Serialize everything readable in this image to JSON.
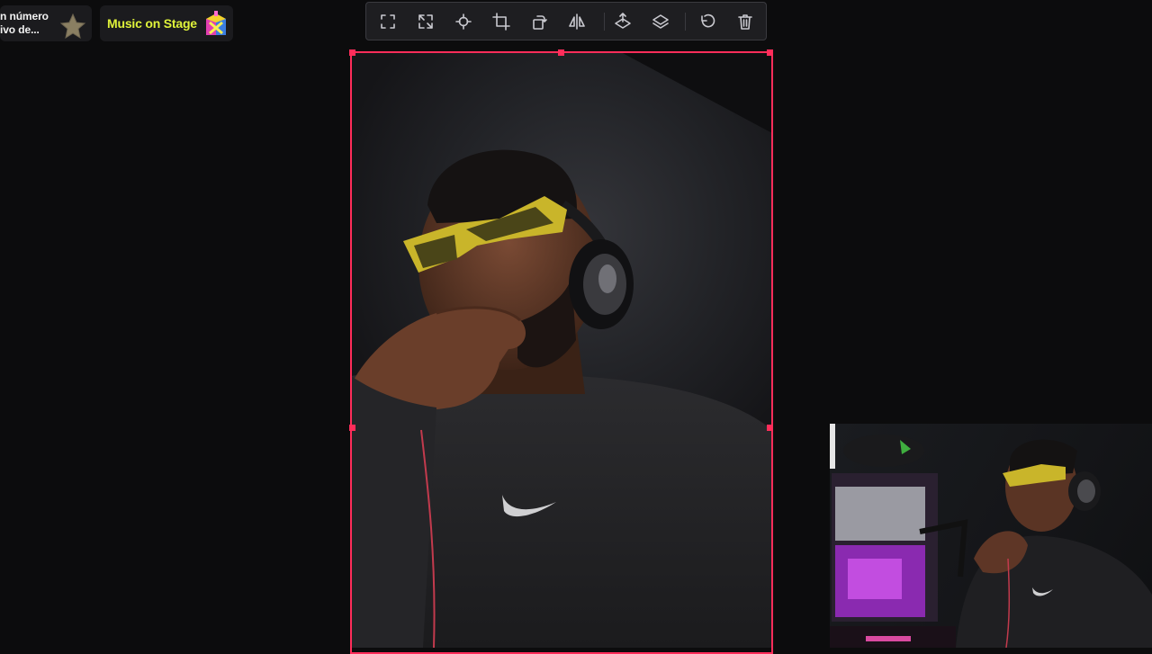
{
  "alerts": [
    {
      "text": "n número\nivo de...",
      "icon": "star-icon"
    },
    {
      "text": "Music on Stage",
      "icon": "gift-box-icon",
      "text_color": "#dff23a"
    }
  ],
  "toolbar": {
    "buttons": [
      {
        "name": "fit-to-screen-button",
        "icon": "expand-corners-icon"
      },
      {
        "name": "stretch-button",
        "icon": "diagonal-arrows-icon"
      },
      {
        "name": "center-button",
        "icon": "crosshair-icon"
      },
      {
        "name": "crop-button",
        "icon": "crop-icon"
      },
      {
        "name": "rotate-button",
        "icon": "rotate-icon"
      },
      {
        "name": "flip-horizontal-button",
        "icon": "flip-horizontal-icon"
      },
      {
        "name": "bring-forward-button",
        "icon": "layer-up-icon"
      },
      {
        "name": "send-backward-button",
        "icon": "layer-down-icon"
      },
      {
        "name": "reset-button",
        "icon": "undo-icon"
      },
      {
        "name": "delete-button",
        "icon": "trash-icon"
      }
    ]
  },
  "selection": {
    "border_color": "#ff2d5a"
  },
  "colors": {
    "background": "#0c0c0d",
    "toolbar_bg": "#1e1e21",
    "accent": "#ff2d5a",
    "glasses": "#c9b52a"
  }
}
